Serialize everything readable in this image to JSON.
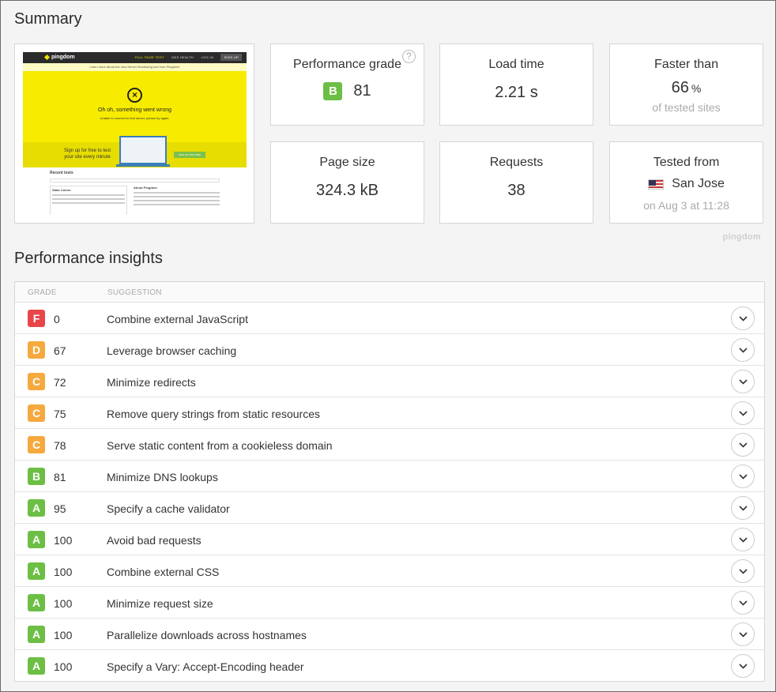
{
  "summary": {
    "title": "Summary",
    "thumbnail": {
      "logo": "pingdom",
      "nav": [
        "FULL PAGE TEST",
        "DNS HEALTH",
        "LOG IN",
        "SIGN UP"
      ],
      "banner": "Learn more about the new Server Monitoring tool from Pingdom!",
      "error_title": "Oh oh, something went wrong",
      "error_sub": "Unable to connect to test server, please try again.",
      "signup_line1": "Sign up for free to test",
      "signup_line2": "your site every minute",
      "signup_button": "SIGN UP FOR FREE",
      "recent_tests": "Recent tests",
      "state_colors": "State Colors",
      "about": "About Pingdom"
    },
    "cards": {
      "grade": {
        "label": "Performance grade",
        "badge": "B",
        "value": "81",
        "help": "?"
      },
      "load_time": {
        "label": "Load time",
        "value": "2.21 s"
      },
      "faster_than": {
        "label": "Faster than",
        "value": "66",
        "unit": "%",
        "sub": "of tested sites"
      },
      "page_size": {
        "label": "Page size",
        "value": "324.3 kB"
      },
      "requests": {
        "label": "Requests",
        "value": "38"
      },
      "tested_from": {
        "label": "Tested from",
        "city": "San Jose",
        "sub": "on Aug 3 at 11:28",
        "flag": "us-flag-icon"
      }
    },
    "brand": "pingdom"
  },
  "insights": {
    "title": "Performance insights",
    "columns": {
      "grade": "GRADE",
      "suggestion": "SUGGESTION"
    },
    "rows": [
      {
        "grade": "F",
        "score": "0",
        "suggestion": "Combine external JavaScript",
        "color": "#e8454b"
      },
      {
        "grade": "D",
        "score": "67",
        "suggestion": "Leverage browser caching",
        "color": "#f5a93e"
      },
      {
        "grade": "C",
        "score": "72",
        "suggestion": "Minimize redirects",
        "color": "#f5a93e"
      },
      {
        "grade": "C",
        "score": "75",
        "suggestion": "Remove query strings from static resources",
        "color": "#f5a93e"
      },
      {
        "grade": "C",
        "score": "78",
        "suggestion": "Serve static content from a cookieless domain",
        "color": "#f5a93e"
      },
      {
        "grade": "B",
        "score": "81",
        "suggestion": "Minimize DNS lookups",
        "color": "#6cbf44"
      },
      {
        "grade": "A",
        "score": "95",
        "suggestion": "Specify a cache validator",
        "color": "#6cbf44"
      },
      {
        "grade": "A",
        "score": "100",
        "suggestion": "Avoid bad requests",
        "color": "#6cbf44"
      },
      {
        "grade": "A",
        "score": "100",
        "suggestion": "Combine external CSS",
        "color": "#6cbf44"
      },
      {
        "grade": "A",
        "score": "100",
        "suggestion": "Minimize request size",
        "color": "#6cbf44"
      },
      {
        "grade": "A",
        "score": "100",
        "suggestion": "Parallelize downloads across hostnames",
        "color": "#6cbf44"
      },
      {
        "grade": "A",
        "score": "100",
        "suggestion": "Specify a Vary: Accept-Encoding header",
        "color": "#6cbf44"
      }
    ]
  }
}
